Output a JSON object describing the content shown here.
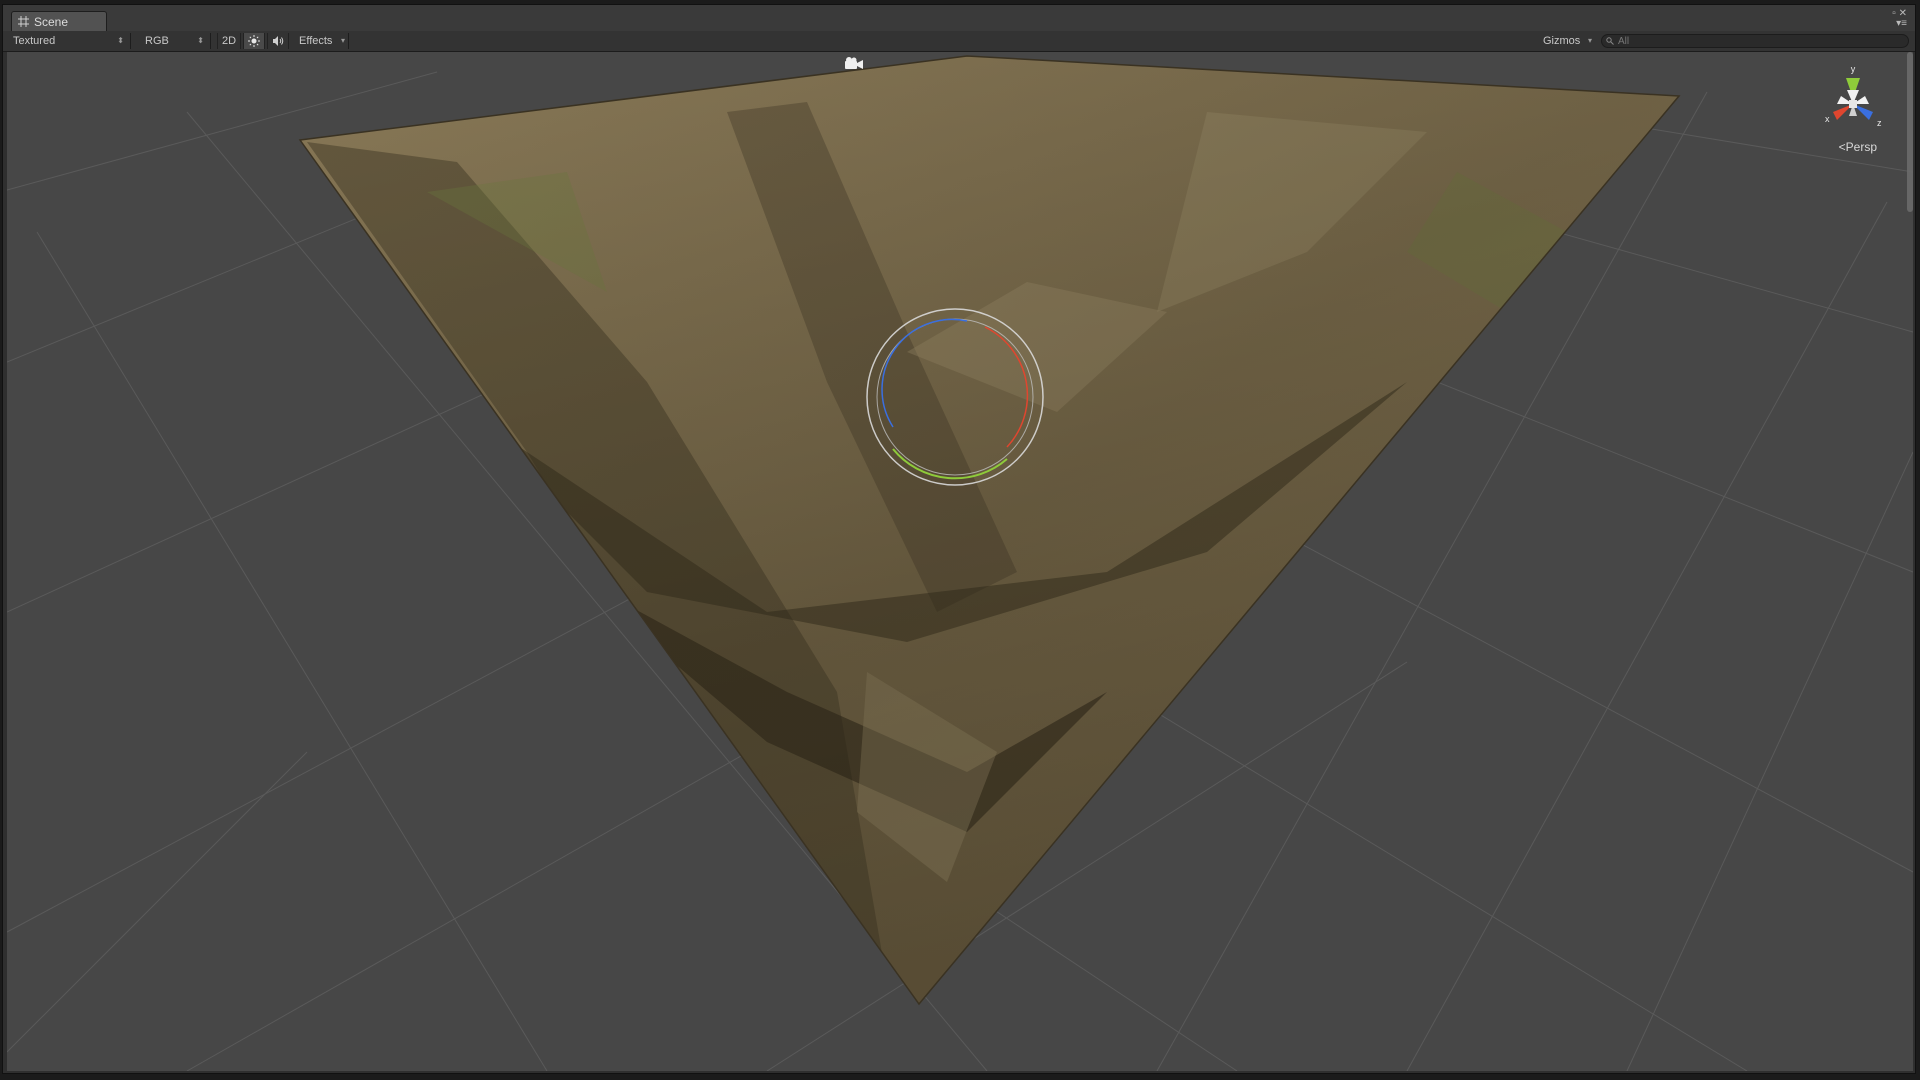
{
  "window": {
    "tab_label": "Scene",
    "tab_icon": "scene-grid-icon"
  },
  "toolbar": {
    "draw_mode": "Textured",
    "render_mode": "RGB",
    "mode_2d": "2D",
    "lighting_icon": "sun-icon",
    "audio_icon": "speaker-icon",
    "effects_label": "Effects",
    "gizmos_label": "Gizmos",
    "search_placeholder": "All"
  },
  "viewport": {
    "projection_label": "Persp",
    "axis_labels": {
      "x": "x",
      "y": "y",
      "z": "z"
    },
    "colors": {
      "background": "#474747",
      "grid": "#5a5a5a",
      "x_axis": "#e0462f",
      "y_axis": "#8ecb3a",
      "z_axis": "#3a6fe0",
      "terrain": "#7a6a4a"
    }
  }
}
